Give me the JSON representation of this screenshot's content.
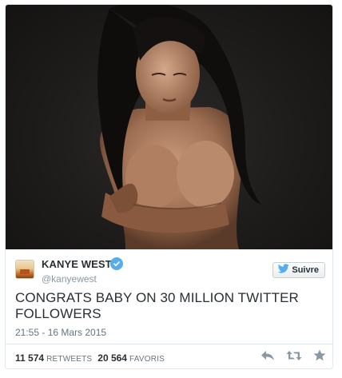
{
  "tweet": {
    "author_name": "KANYE WEST",
    "author_handle": "@kanyewest",
    "follow_label": "Suivre",
    "text": "CONGRATS BABY ON 30 MILLION TWITTER FOLLOWERS",
    "timestamp": "21:55 - 16 Mars 2015",
    "retweets_count": "11 574",
    "retweets_label": "RETWEETS",
    "favorites_count": "20 564",
    "favorites_label": "FAVORIS"
  },
  "icons": {
    "verified": "verified-badge-icon",
    "follow": "twitter-bird-icon",
    "reply": "reply-icon",
    "retweet": "retweet-icon",
    "favorite": "star-icon"
  },
  "colors": {
    "accent": "#55acee",
    "text": "#292f33",
    "muted": "#66757f",
    "action_icon": "#8899a6",
    "photo_background": "#1d1c1b"
  }
}
